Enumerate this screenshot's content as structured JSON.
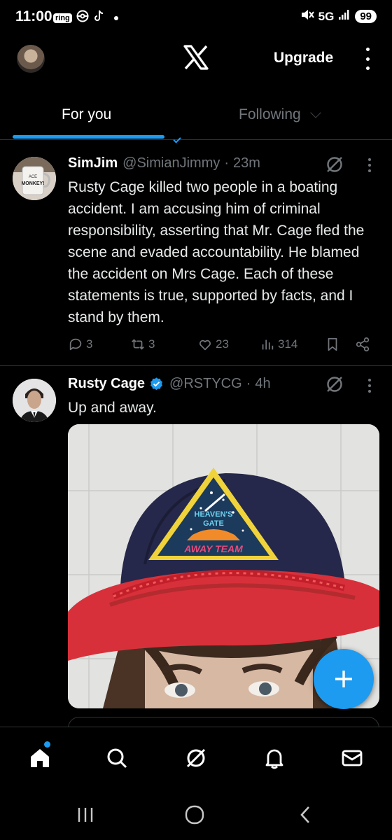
{
  "status_bar": {
    "time": "11:00",
    "ring_label": "ring",
    "network": "5G",
    "battery": "99",
    "icons": [
      "ring-app-icon",
      "pokeball-icon",
      "tiktok-icon",
      "dot-indicator",
      "mute-icon",
      "signal-icon",
      "battery-icon"
    ]
  },
  "header": {
    "upgrade_label": "Upgrade",
    "logo": "x-logo-icon"
  },
  "tabs": [
    {
      "label": "For you",
      "active": true
    },
    {
      "label": "Following",
      "active": false
    }
  ],
  "posts": [
    {
      "name": "SimJim",
      "handle": "@SimianJimmy",
      "separator": "·",
      "time": "23m",
      "text": "Rusty Cage killed two people in a boating accident. I am accusing him of criminal responsibility, asserting that Mr. Cage fled the scene and evaded accountability. He blamed the accident on Mrs Cage. Each of these statements is true, supported by facts, and I stand by them.",
      "replies": "3",
      "reposts": "3",
      "likes": "23",
      "views": "314",
      "avatar_mug_text": "MONKEY!"
    },
    {
      "name": "Rusty Cage",
      "handle": "@RSTYCG",
      "separator": "·",
      "time": "4h",
      "verified": true,
      "text": "Up and away.",
      "image_patch_lines": [
        "HEAVEN'S",
        "GATE",
        "AWAY TEAM"
      ]
    }
  ],
  "nav": [
    "home-icon",
    "search-icon",
    "grok-icon",
    "notifications-icon",
    "messages-icon"
  ],
  "colors": {
    "accent": "#1d9bf0",
    "text": "#e7e9ea",
    "muted": "#71767b",
    "divider": "#2f3336",
    "background": "#000000"
  }
}
